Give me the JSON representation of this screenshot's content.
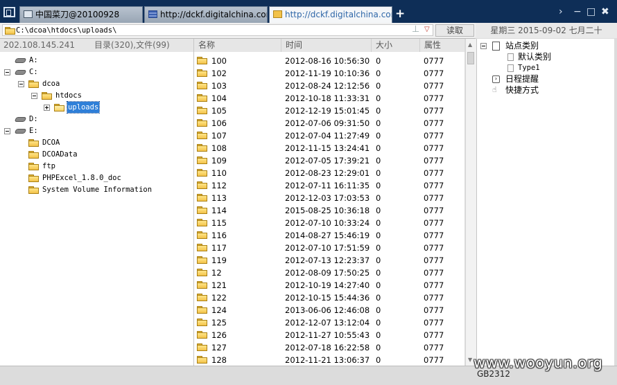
{
  "tabs": [
    {
      "label": "中国菜刀@20100928",
      "icon": "page-icon",
      "active": false
    },
    {
      "label": "http://dckf.digitalchina.com/u...",
      "icon": "flag-icon",
      "active": false
    },
    {
      "label": "http://dckf.digitalchina.com/u...",
      "icon": "folder-icon",
      "active": true
    }
  ],
  "new_tab": "+",
  "window_buttons": {
    "next": "›",
    "minimize": "−",
    "maximize": "□",
    "close": "✖"
  },
  "address": {
    "path": "C:\\dcoa\\htdocs\\uploads\\",
    "up": "⊥",
    "dropdown": "▽"
  },
  "read_button": "读取",
  "date": "星期三 2015-09-02 七月二十",
  "left_header": {
    "ip": "202.108.145.241",
    "counts": "目录(320),文件(99)"
  },
  "tree": [
    {
      "label": "A:",
      "type": "drive",
      "expander": "",
      "selected": false
    },
    {
      "label": "C:",
      "type": "drive",
      "expander": "minus",
      "selected": false
    },
    {
      "label": "dcoa",
      "type": "folder",
      "expander": "minus",
      "selected": false
    },
    {
      "label": "htdocs",
      "type": "folder",
      "expander": "minus",
      "selected": false
    },
    {
      "label": "uploads",
      "type": "folder-open",
      "expander": "plus",
      "selected": true
    },
    {
      "label": "D:",
      "type": "drive",
      "expander": "",
      "selected": false
    },
    {
      "label": "E:",
      "type": "drive",
      "expander": "minus",
      "selected": false
    },
    {
      "label": "DCOA",
      "type": "folder",
      "expander": "",
      "selected": false
    },
    {
      "label": "DCOAData",
      "type": "folder",
      "expander": "",
      "selected": false
    },
    {
      "label": "ftp",
      "type": "folder",
      "expander": "",
      "selected": false
    },
    {
      "label": "PHPExcel_1.8.0_doc",
      "type": "folder",
      "expander": "",
      "selected": false
    },
    {
      "label": "System Volume Information",
      "type": "folder",
      "expander": "",
      "selected": false
    }
  ],
  "columns": {
    "name": "名称",
    "time": "时间",
    "size": "大小",
    "attr": "属性"
  },
  "files": [
    {
      "name": "100",
      "time": "2012-08-16 10:56:30",
      "size": "0",
      "attr": "0777"
    },
    {
      "name": "102",
      "time": "2012-11-19 10:10:36",
      "size": "0",
      "attr": "0777"
    },
    {
      "name": "103",
      "time": "2012-08-24 12:12:56",
      "size": "0",
      "attr": "0777"
    },
    {
      "name": "104",
      "time": "2012-10-18 11:33:31",
      "size": "0",
      "attr": "0777"
    },
    {
      "name": "105",
      "time": "2012-12-19 15:01:45",
      "size": "0",
      "attr": "0777"
    },
    {
      "name": "106",
      "time": "2012-07-06 09:31:50",
      "size": "0",
      "attr": "0777"
    },
    {
      "name": "107",
      "time": "2012-07-04 11:27:49",
      "size": "0",
      "attr": "0777"
    },
    {
      "name": "108",
      "time": "2012-11-15 13:24:41",
      "size": "0",
      "attr": "0777"
    },
    {
      "name": "109",
      "time": "2012-07-05 17:39:21",
      "size": "0",
      "attr": "0777"
    },
    {
      "name": "110",
      "time": "2012-08-23 12:29:01",
      "size": "0",
      "attr": "0777"
    },
    {
      "name": "112",
      "time": "2012-07-11 16:11:35",
      "size": "0",
      "attr": "0777"
    },
    {
      "name": "113",
      "time": "2012-12-03 17:03:53",
      "size": "0",
      "attr": "0777"
    },
    {
      "name": "114",
      "time": "2015-08-25 10:36:18",
      "size": "0",
      "attr": "0777"
    },
    {
      "name": "115",
      "time": "2012-07-10 10:33:24",
      "size": "0",
      "attr": "0777"
    },
    {
      "name": "116",
      "time": "2014-08-27 15:46:19",
      "size": "0",
      "attr": "0777"
    },
    {
      "name": "117",
      "time": "2012-07-10 17:51:59",
      "size": "0",
      "attr": "0777"
    },
    {
      "name": "119",
      "time": "2012-07-13 12:23:37",
      "size": "0",
      "attr": "0777"
    },
    {
      "name": "12",
      "time": "2012-08-09 17:50:25",
      "size": "0",
      "attr": "0777"
    },
    {
      "name": "121",
      "time": "2012-10-19 14:27:40",
      "size": "0",
      "attr": "0777"
    },
    {
      "name": "122",
      "time": "2012-10-15 15:44:36",
      "size": "0",
      "attr": "0777"
    },
    {
      "name": "124",
      "time": "2013-06-06 12:46:08",
      "size": "0",
      "attr": "0777"
    },
    {
      "name": "125",
      "time": "2012-12-07 13:12:04",
      "size": "0",
      "attr": "0777"
    },
    {
      "name": "126",
      "time": "2012-11-27 10:55:43",
      "size": "0",
      "attr": "0777"
    },
    {
      "name": "127",
      "time": "2012-07-18 16:22:58",
      "size": "0",
      "attr": "0777"
    },
    {
      "name": "128",
      "time": "2012-11-21 13:06:37",
      "size": "0",
      "attr": "0777"
    }
  ],
  "right_tree": [
    {
      "label": "站点类别",
      "icon": "category-icon",
      "expander": "minus",
      "indent": 0
    },
    {
      "label": "默认类别",
      "icon": "page-icon",
      "expander": "",
      "indent": 1
    },
    {
      "label": "Type1",
      "icon": "page-icon",
      "expander": "",
      "indent": 1
    },
    {
      "label": "日程提醒",
      "icon": "calendar-icon",
      "expander": "",
      "indent": 0
    },
    {
      "label": "快捷方式",
      "icon": "hand-icon",
      "expander": "",
      "indent": 0
    }
  ],
  "status": {
    "charset": "GB2312"
  },
  "watermark": "www.wooyun.org",
  "colors": {
    "titlebar": "#0e2e57",
    "active_tab_text": "#2f67a8",
    "selection": "#2f7fd8",
    "folder": "#f3c34a"
  }
}
